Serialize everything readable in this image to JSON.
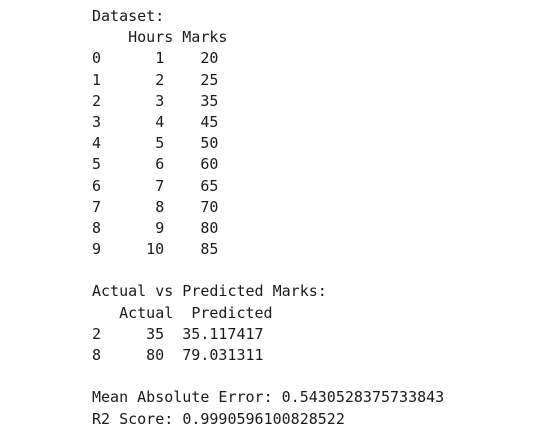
{
  "dataset": {
    "heading": "Dataset:",
    "columns": [
      "Hours",
      "Marks"
    ],
    "rows": [
      {
        "index": "0",
        "hours": "1",
        "marks": "20"
      },
      {
        "index": "1",
        "hours": "2",
        "marks": "25"
      },
      {
        "index": "2",
        "hours": "3",
        "marks": "35"
      },
      {
        "index": "3",
        "hours": "4",
        "marks": "45"
      },
      {
        "index": "4",
        "hours": "5",
        "marks": "50"
      },
      {
        "index": "5",
        "hours": "6",
        "marks": "60"
      },
      {
        "index": "6",
        "hours": "7",
        "marks": "65"
      },
      {
        "index": "7",
        "hours": "8",
        "marks": "70"
      },
      {
        "index": "8",
        "hours": "9",
        "marks": "80"
      },
      {
        "index": "9",
        "hours": "10",
        "marks": "85"
      }
    ]
  },
  "predictions": {
    "heading": "Actual vs Predicted Marks:",
    "columns": [
      "Actual",
      "Predicted"
    ],
    "rows": [
      {
        "index": "2",
        "actual": "35",
        "predicted": "35.117417"
      },
      {
        "index": "8",
        "actual": "80",
        "predicted": "79.031311"
      }
    ]
  },
  "metrics": {
    "mae_label": "Mean Absolute Error:",
    "mae_value": "0.5430528375733843",
    "r2_label": "R2 Score:",
    "r2_value": "0.9990596100828522"
  }
}
